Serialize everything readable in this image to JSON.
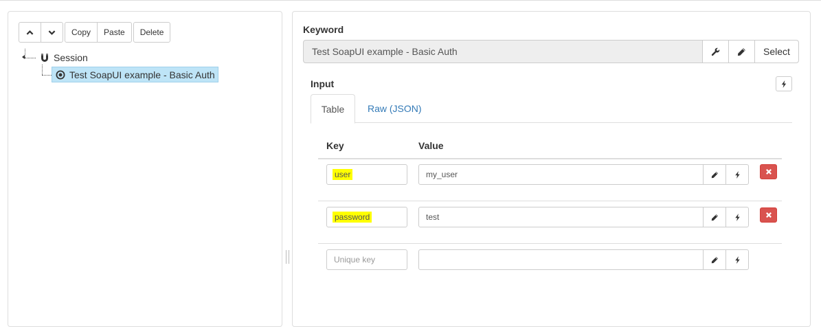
{
  "toolbar": {
    "move_up_icon": "chevron-up-icon",
    "move_down_icon": "chevron-down-icon",
    "copy_label": "Copy",
    "paste_label": "Paste",
    "delete_label": "Delete"
  },
  "tree": {
    "root": {
      "label": "Session",
      "icon": "magnet-icon"
    },
    "child": {
      "label": "Test SoapUI example - Basic Auth",
      "icon": "target-icon",
      "selected": true
    }
  },
  "keyword": {
    "label": "Keyword",
    "value": "Test SoapUI example - Basic Auth",
    "configure_icon": "wrench-icon",
    "edit_icon": "pencil-icon",
    "select_label": "Select"
  },
  "input": {
    "label": "Input",
    "tabs": [
      {
        "label": "Table",
        "active": true
      },
      {
        "label": "Raw (JSON)",
        "active": false
      }
    ],
    "columns": {
      "key": "Key",
      "value": "Value"
    },
    "rows": [
      {
        "key": "user",
        "value": "my_user"
      },
      {
        "key": "password",
        "value": "test"
      }
    ],
    "new_row": {
      "key_placeholder": "Unique key",
      "value": ""
    }
  },
  "colors": {
    "selection": "#bee4f7",
    "highlight": "#ffff00",
    "danger": "#d9534f",
    "link": "#337ab7"
  }
}
